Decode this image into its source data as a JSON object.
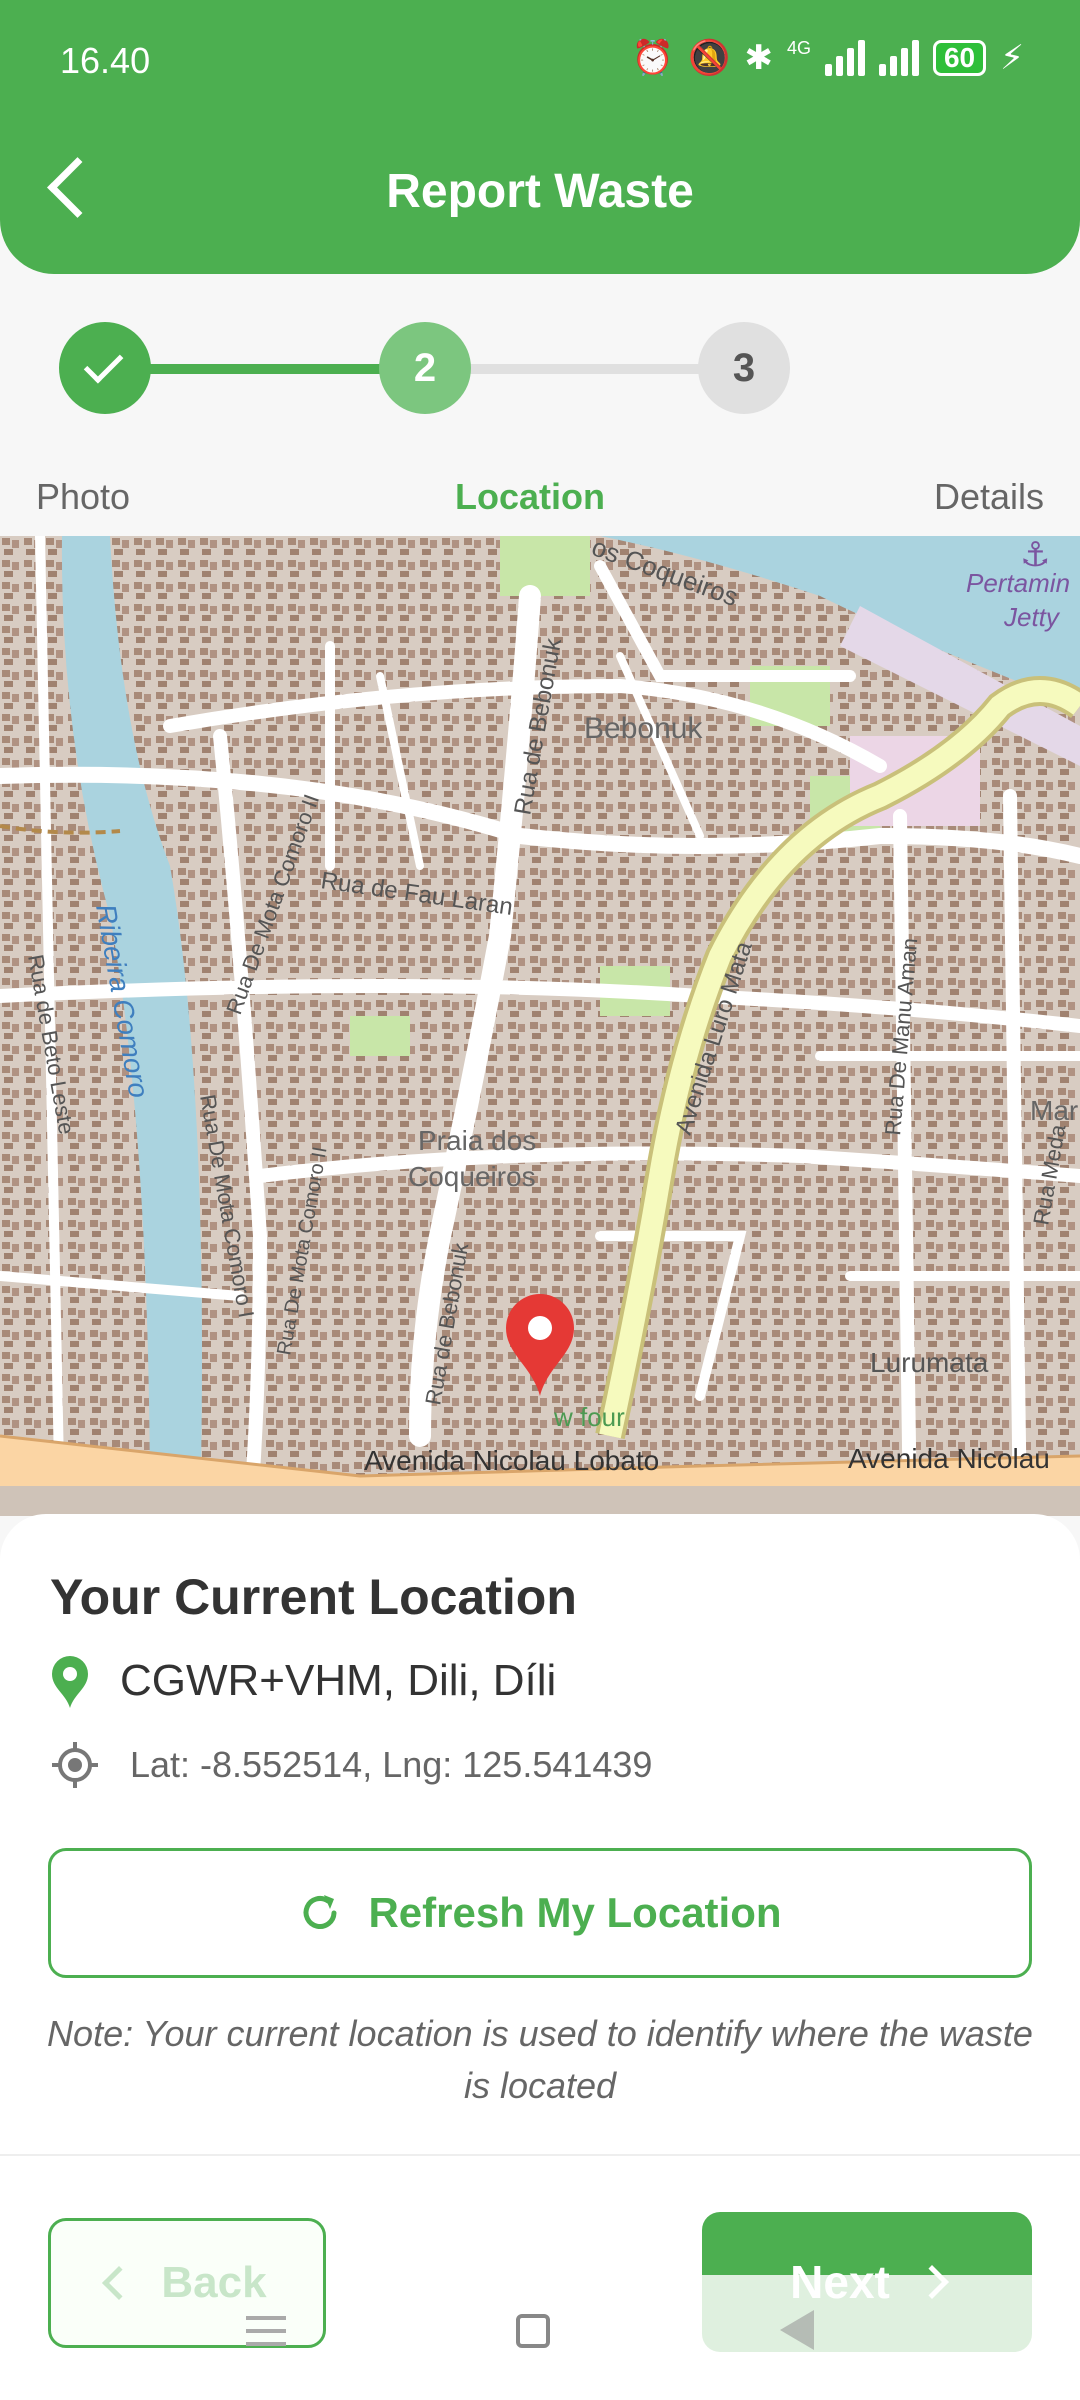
{
  "status_bar": {
    "time": "16.40",
    "battery": "60",
    "network": "4G"
  },
  "header": {
    "title": "Report Waste"
  },
  "stepper": {
    "steps": [
      {
        "number": "1",
        "label": "Photo",
        "state": "done"
      },
      {
        "number": "2",
        "label": "Location",
        "state": "active"
      },
      {
        "number": "3",
        "label": "Details",
        "state": "pending"
      }
    ]
  },
  "map": {
    "labels": {
      "coqueiros_top": "os Coqueiros",
      "pertamina": "Pertamin",
      "jetty": "Jetty",
      "bebonuk": "Bebonuk",
      "rua_bebonuk_top": "Rua de Bebonuk",
      "rua_fau_laran": "Rua de Fau Laran",
      "rua_mota_comoro_ii": "Rua De Mota Comoro II",
      "ribeira_comoro": "Ribeira Comoro",
      "rua_beto_leste": "Rua de Beto Leste",
      "avenida_luro_mata": "Avenida Luro Mata",
      "rua_manu_aman": "Rua De Manu Aman",
      "marko": "Marko",
      "rua_meda": "Rua Meda",
      "praia_line1": "Praia dos",
      "praia_line2": "Coqueiros",
      "rua_mota_comoro_i": "Rua De Mota Comoro I",
      "rua_mota_comoro_ii_b": "Rua De Mota Comoro II",
      "rua_bebonuk_bottom": "Rua de Bebonuk",
      "w_four": "w four",
      "lurumata": "Lurumata",
      "avenida_nicolau_lobato": "Avenida Nicolau Lobato",
      "avenida_nicolau": "Avenida Nicolau"
    }
  },
  "location_card": {
    "title": "Your Current Location",
    "address": "CGWR+VHM, Dili, Díli",
    "coordinates": "Lat: -8.552514, Lng: 125.541439",
    "refresh_label": "Refresh My Location",
    "note": "Note: Your current location is used to identify where the waste is located"
  },
  "actions": {
    "back_label": "Back",
    "next_label": "Next"
  },
  "colors": {
    "primary": "#4caf50",
    "pin": "#e53935",
    "water": "#aad3df",
    "road_major": "#f6fabe"
  }
}
